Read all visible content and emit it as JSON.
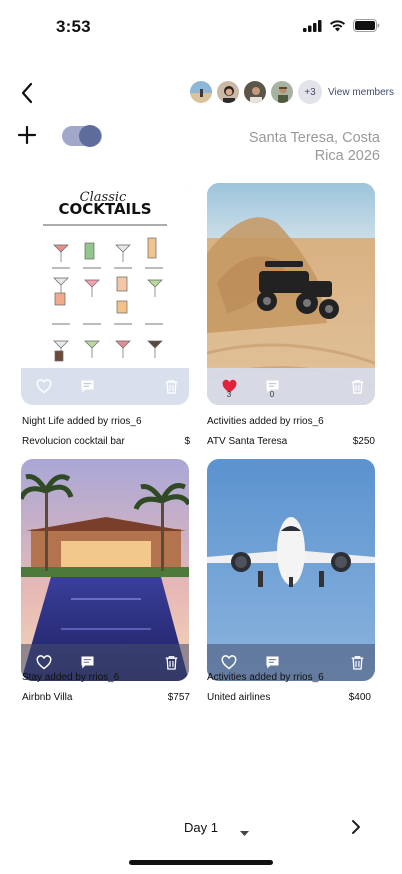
{
  "status_bar": {
    "time": "3:53"
  },
  "header": {
    "members_more": "+3",
    "view_members_label": "View members",
    "avatars": [
      "beach-avatar",
      "woman-avatar",
      "man-avatar",
      "hiker-avatar"
    ]
  },
  "toolbar": {
    "trip_title": "Santa Teresa, Costa Rica 2026",
    "toggle_on": true
  },
  "cards": [
    {
      "category": "Night Life",
      "added_by_label": "added by",
      "user": "rrios_6",
      "name": "Revolucion cocktail bar",
      "price": "$",
      "liked": false,
      "likes": "",
      "comments": "",
      "image": {
        "title_script": "Classic",
        "title": "COCKTAILS"
      }
    },
    {
      "category": "Activities",
      "added_by_label": "added by",
      "user": "rrios_6",
      "name": "ATV Santa Teresa",
      "price": "$250",
      "liked": true,
      "likes": "3",
      "comments": "0"
    },
    {
      "category": "Stay",
      "added_by_label": "added by",
      "user": "rrios_6",
      "name": "Airbnb Villa",
      "price": "$757",
      "liked": false,
      "likes": "",
      "comments": ""
    },
    {
      "category": "Activities",
      "added_by_label": "added by",
      "user": "rrios_6",
      "name": "United airlines",
      "price": "$400",
      "liked": false,
      "likes": "",
      "comments": ""
    }
  ],
  "footer": {
    "day_label": "Day 1"
  },
  "colors": {
    "accent": "#5d6b9d",
    "liked": "#e0223a",
    "link": "#3e4a76"
  }
}
